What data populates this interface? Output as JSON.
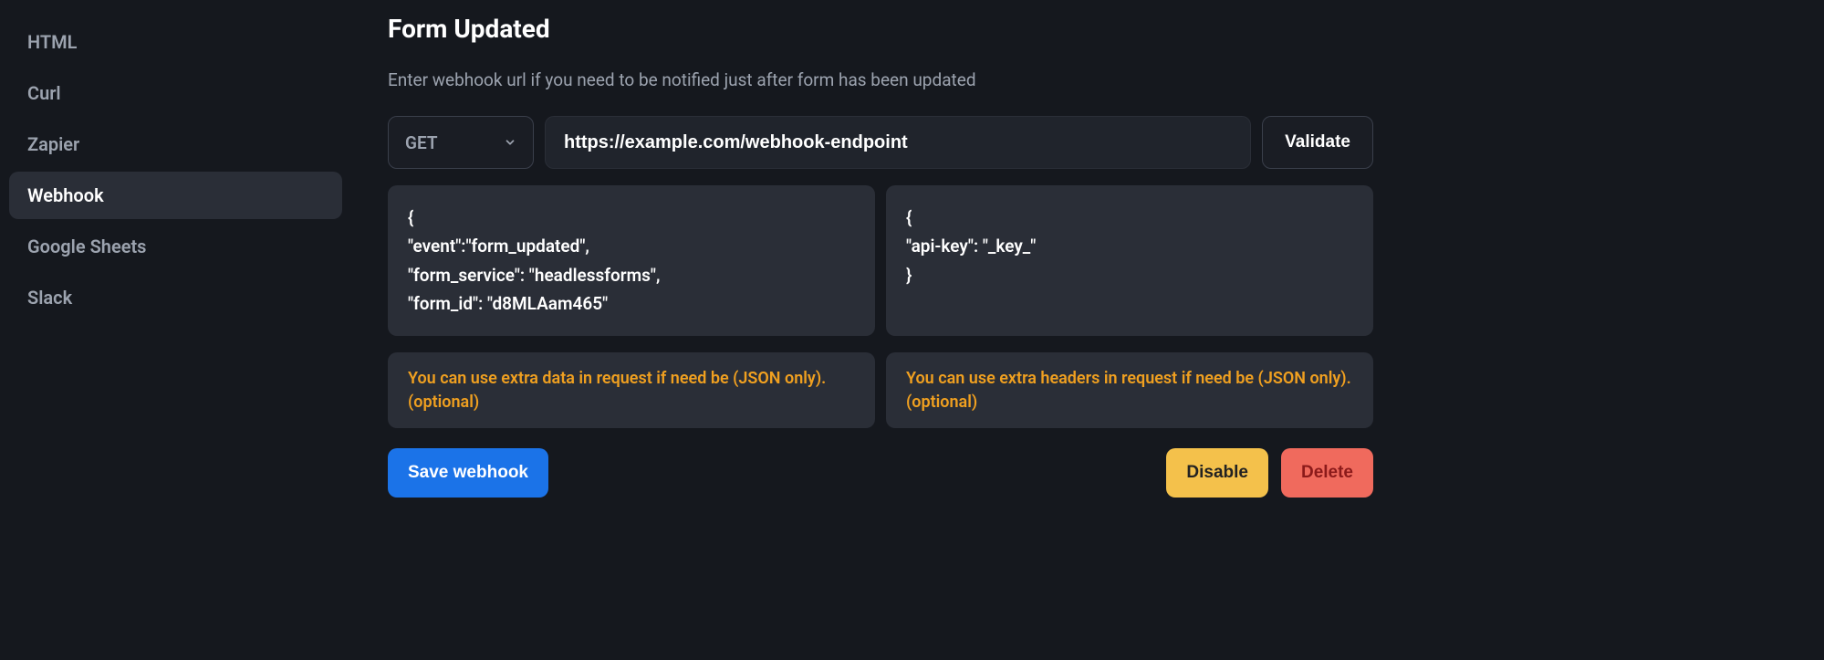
{
  "sidebar": {
    "items": [
      {
        "label": "HTML",
        "active": false
      },
      {
        "label": "Curl",
        "active": false
      },
      {
        "label": "Zapier",
        "active": false
      },
      {
        "label": "Webhook",
        "active": true
      },
      {
        "label": "Google Sheets",
        "active": false
      },
      {
        "label": "Slack",
        "active": false
      }
    ]
  },
  "main": {
    "title": "Form Updated",
    "subtitle": "Enter webhook url if you need to be notified just after form has been updated",
    "method": "GET",
    "url": "https://example.com/webhook-endpoint",
    "validate_label": "Validate",
    "body_code": "{\n\"event\":\"form_updated\",\n\"form_service\": \"headlessforms\",\n\"form_id\": \"d8MLAam465\"",
    "headers_code": "{\n\"api-key\": \"_key_\"\n}",
    "body_hint": "You can use extra data in request if need be (JSON only). (optional)",
    "headers_hint": "You can use extra headers in request if need be (JSON only). (optional)",
    "save_label": "Save webhook",
    "disable_label": "Disable",
    "delete_label": "Delete"
  }
}
